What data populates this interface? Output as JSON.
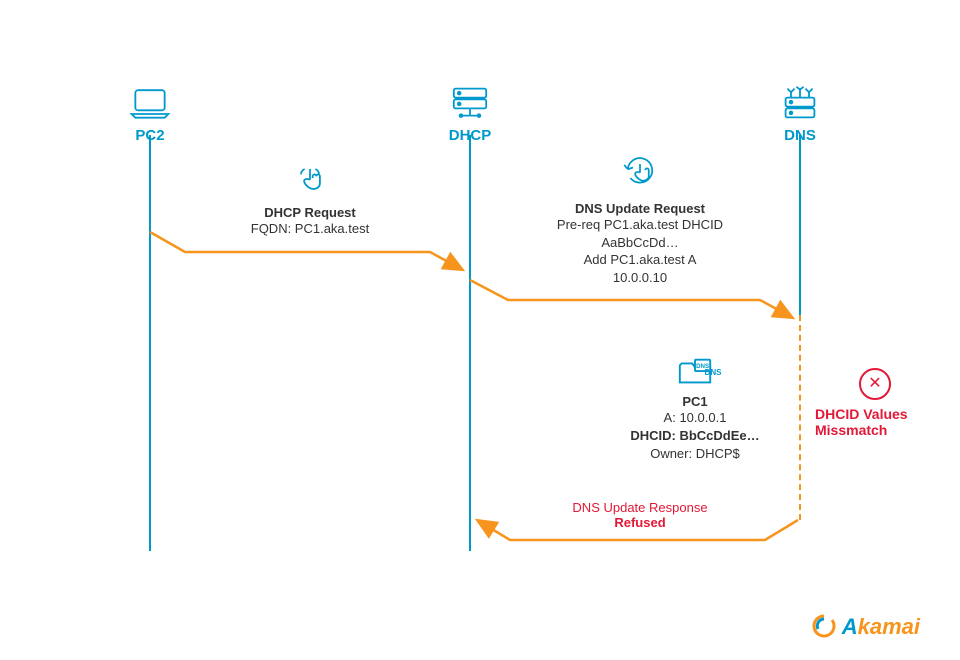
{
  "actors": {
    "pc2": {
      "label": "PC2"
    },
    "dhcp": {
      "label": "DHCP"
    },
    "dns": {
      "label": "DNS"
    }
  },
  "messages": {
    "dhcp_req": {
      "title": "DHCP Request",
      "line1": "FQDN: PC1.aka.test"
    },
    "dns_update_req": {
      "title": "DNS Update Request",
      "line1": "Pre-req PC1.aka.test DHCID",
      "line2": "AaBbCcDd…",
      "line3": "Add PC1.aka.test A",
      "line4": "10.0.0.10"
    },
    "record": {
      "folder_label": "DNS",
      "host": "PC1",
      "a": "A: 10.0.0.1",
      "dhcid": "DHCID: BbCcDdEe…",
      "owner": "Owner: DHCP$"
    },
    "mismatch": {
      "line1": "DHCID Values",
      "line2": "Missmatch"
    },
    "dns_update_resp": {
      "title": "DNS Update Response",
      "result": "Refused"
    }
  },
  "brand": {
    "a": "A",
    "rest": "kamai"
  },
  "colors": {
    "blue": "#0099cc",
    "orange": "#f7941d",
    "red": "#e31837"
  }
}
